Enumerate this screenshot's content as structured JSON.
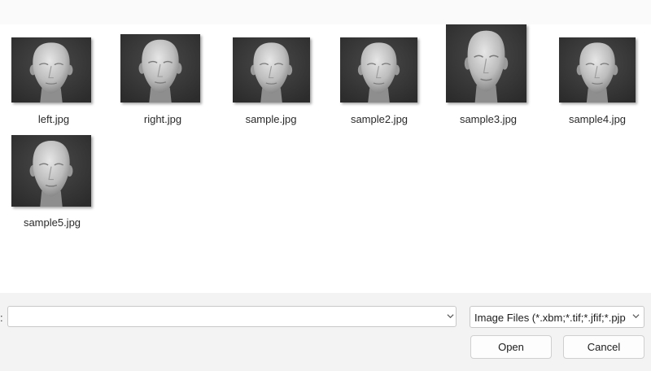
{
  "files": [
    {
      "name": "left.jpg",
      "icon": "head-image-icon"
    },
    {
      "name": "right.jpg",
      "icon": "head-image-icon"
    },
    {
      "name": "sample.jpg",
      "icon": "head-image-icon"
    },
    {
      "name": "sample2.jpg",
      "icon": "head-image-icon"
    },
    {
      "name": "sample3.jpg",
      "icon": "head-image-icon"
    },
    {
      "name": "sample4.jpg",
      "icon": "head-image-icon"
    },
    {
      "name": "sample5.jpg",
      "icon": "head-image-icon"
    }
  ],
  "footer": {
    "filename_prefix": ":",
    "filename_value": "",
    "filetype_selected": "Image Files (*.xbm;*.tif;*.jfif;*.pjp",
    "open_label": "Open",
    "cancel_label": "Cancel"
  },
  "colors": {
    "thumb_background": "#2c2c2c",
    "head_fill": "#bcbcbc",
    "footer_background": "#f3f3f3"
  }
}
